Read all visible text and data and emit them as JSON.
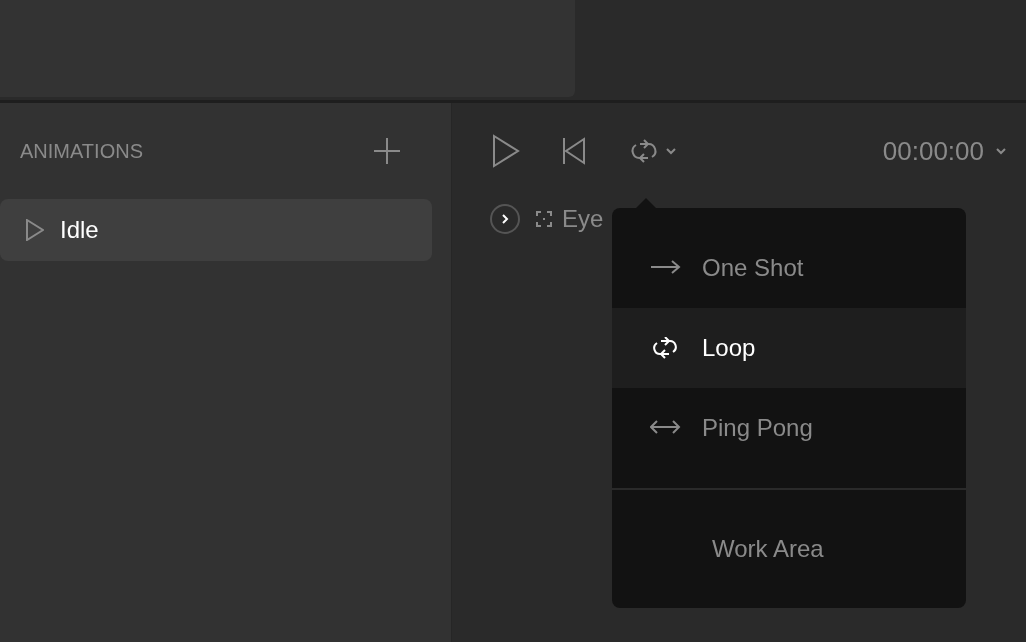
{
  "animations_panel": {
    "title": "ANIMATIONS",
    "items": [
      {
        "label": "Idle",
        "selected": true
      }
    ]
  },
  "playback": {
    "time": "00:00:00"
  },
  "timeline": {
    "rows": [
      {
        "label": "Eye",
        "expanded": false
      }
    ]
  },
  "loop_menu": {
    "items": [
      {
        "kind": "one_shot",
        "label": "One Shot",
        "selected": false
      },
      {
        "kind": "loop",
        "label": "Loop",
        "selected": true
      },
      {
        "kind": "ping_pong",
        "label": "Ping Pong",
        "selected": false
      }
    ],
    "extra": {
      "label": "Work Area"
    }
  }
}
